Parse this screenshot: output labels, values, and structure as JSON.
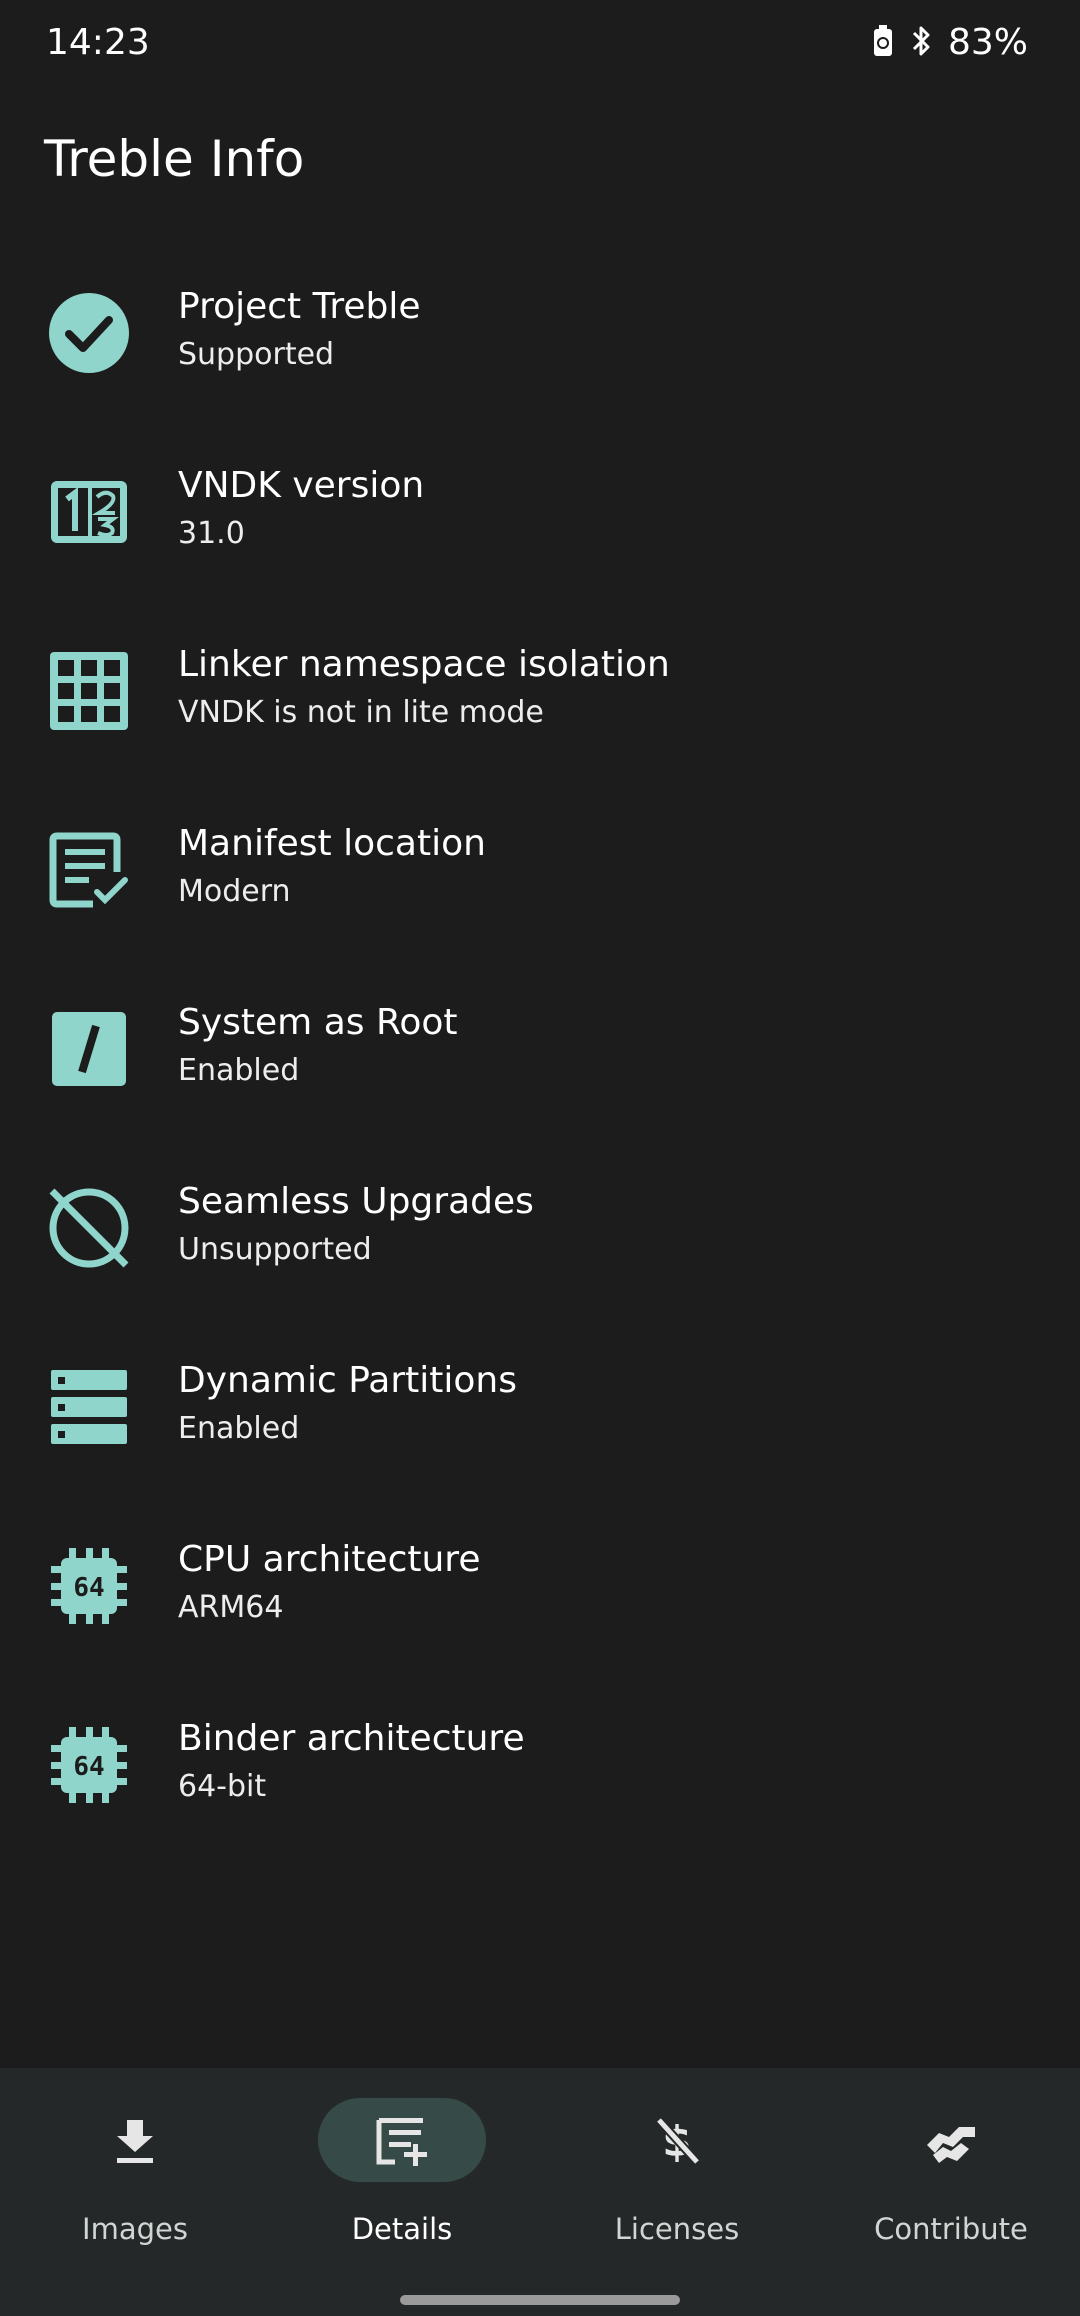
{
  "status_bar": {
    "time": "14:23",
    "battery_percent": "83%",
    "icons": [
      "battery-saver-icon",
      "bluetooth-icon"
    ]
  },
  "app": {
    "title": "Treble Info"
  },
  "accent_color": "#8fd5cb",
  "items": [
    {
      "title": "Project Treble",
      "subtitle": "Supported",
      "icon": "check-circle-icon"
    },
    {
      "title": "VNDK version",
      "subtitle": "31.0",
      "icon": "numbers-icon"
    },
    {
      "title": "Linker namespace isolation",
      "subtitle": "VNDK is not in lite mode",
      "icon": "grid-icon"
    },
    {
      "title": "Manifest location",
      "subtitle": "Modern",
      "icon": "checklist-document-icon"
    },
    {
      "title": "System as Root",
      "subtitle": "Enabled",
      "icon": "slash-square-icon"
    },
    {
      "title": "Seamless Upgrades",
      "subtitle": "Unsupported",
      "icon": "disabled-circle-icon"
    },
    {
      "title": "Dynamic Partitions",
      "subtitle": "Enabled",
      "icon": "storage-icon"
    },
    {
      "title": "CPU architecture",
      "subtitle": "ARM64",
      "icon": "chip-64-icon"
    },
    {
      "title": "Binder architecture",
      "subtitle": "64-bit",
      "icon": "chip-64-icon"
    }
  ],
  "bottom_nav": {
    "selected": "Details",
    "items": [
      {
        "label": "Images",
        "icon": "download-icon"
      },
      {
        "label": "Details",
        "icon": "playlist-add-icon"
      },
      {
        "label": "Licenses",
        "icon": "money-off-icon"
      },
      {
        "label": "Contribute",
        "icon": "handshake-icon"
      }
    ]
  }
}
